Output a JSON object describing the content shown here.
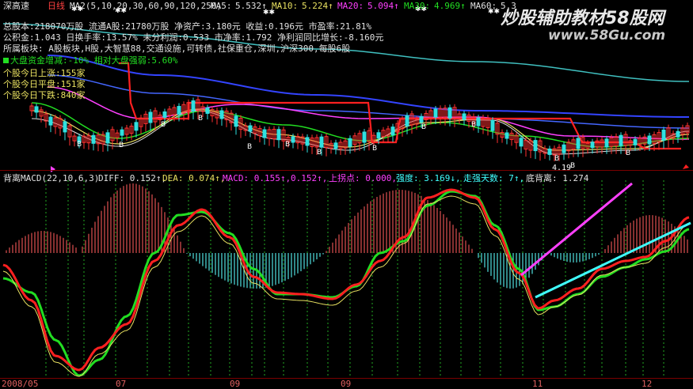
{
  "colors": {
    "bg": "#000000",
    "red": "#ff2020",
    "green": "#22dd22",
    "yellow": "#e8e060",
    "cyan": "#40ffff",
    "magenta": "#ff40ff",
    "blue": "#3344ff",
    "white": "#e0e0e0"
  },
  "header": {
    "stock_name": "深高速",
    "period": "日线",
    "ma_params": "MA2(5,10,20,30,60,90,120,250)",
    "ma5_label": "MA5:",
    "ma5_value": "5.532↑",
    "ma10_label": "MA10:",
    "ma10_value": "5.224↑",
    "ma20_label": "MA20:",
    "ma20_value": "5.094↑",
    "ma30_label": "MA30:",
    "ma30_value": "4.969↑",
    "ma60_label": "MA60:",
    "ma60_value": "5.3"
  },
  "info_lines": [
    "总股本:218070万股 流通A股:21780万股  净资产:3.180元  收益:0.196元  市盈率:21.81%",
    "公积金:1.043   日换手率:13.57%  未分利润:0.533   市净率:1.792   净利润同比增长:-8.160元",
    "所属板块: A股板块,H股,大智慧88,交通设施,可转债,社保重仓,深圳,沪深300,每股6股"
  ],
  "market_lines": {
    "fund": "大盘资金增减:-10%  相对大盘强弱:5.60%",
    "up": "个股今日上涨:155家",
    "flat": "个股今日平盘:151家",
    "down": "个股今日下跌:840家"
  },
  "price_labels": {
    "low_price": "4.19"
  },
  "macd_header": {
    "name": "背离MACD(22,10,6,3)",
    "diff": "DIFF: 0.152↑,",
    "dea": "DEA: 0.074↑,",
    "macd": "MACD: 0.155↑,",
    "v2": "0.152↑,",
    "turn": "上拐点: 0.000,",
    "strength": "强度: 3.169↓,",
    "days": "走强天数: 7↑,",
    "div": "底背离: 1.274"
  },
  "x_axis": [
    "2008/05",
    "07",
    "09",
    "09",
    "11",
    "12"
  ],
  "watermark": {
    "title": "炒股辅助教材58股网",
    "url": "www.58Gu.com"
  }
}
